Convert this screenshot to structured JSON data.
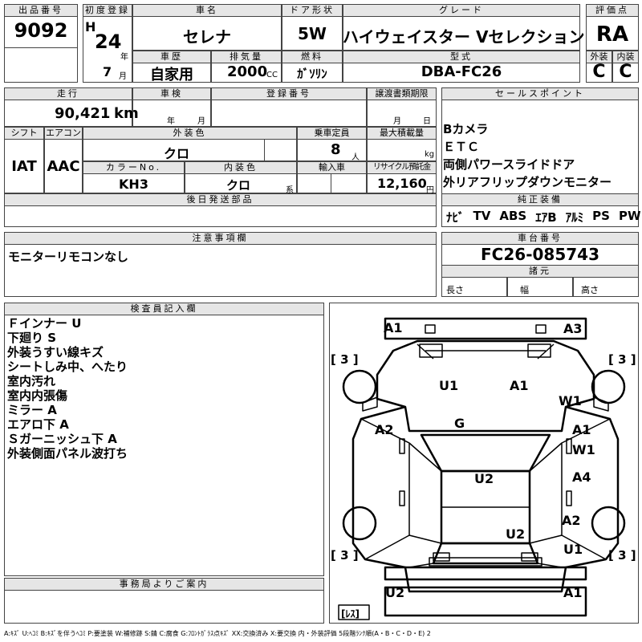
{
  "header": {
    "lot_label": "出品番号",
    "lot": "9092",
    "first_reg_label": "初度登録",
    "era": "H",
    "year": "24",
    "year_unit": "年",
    "month": "7",
    "month_unit": "月",
    "car_name_label": "車名",
    "car_name": "セレナ",
    "door_label": "ドア形状",
    "door": "5W",
    "grade_label": "グレード",
    "grade": "ハイウェイスター Vセレクション",
    "score_label": "評価点",
    "score": "RA",
    "history_label": "車歴",
    "history": "自家用",
    "displacement_label": "排気量",
    "displacement": "2000",
    "displacement_unit": "CC",
    "fuel_label": "燃料",
    "fuel": "ｶﾞｿﾘﾝ",
    "model_label": "型式",
    "model": "DBA-FC26",
    "ext_label": "外装",
    "ext": "C",
    "int_label": "内装",
    "int": "C"
  },
  "row2": {
    "mileage_label": "走行",
    "mileage": "90,421",
    "mileage_unit": "km",
    "inspection_label": "車検",
    "insp_year_unit": "年",
    "insp_month_unit": "月",
    "registration_label": "登録番号",
    "transfer_label": "譲渡書類期限",
    "transfer_month_unit": "月",
    "transfer_day_unit": "日",
    "shift_label": "シフト",
    "shift": "IAT",
    "ac_label": "エアコン",
    "ac": "AAC",
    "color_label": "外装色",
    "color": "クロ",
    "capacity_label": "乗車定員",
    "capacity": "8",
    "capacity_unit": "人",
    "load_label": "最大積載量",
    "load_unit": "kg",
    "color_no_label": "カラーNo.",
    "color_no": "KH3",
    "int_color_label": "内装色",
    "int_color": "クロ",
    "int_color_unit": "系",
    "import_label": "輸入車",
    "recycle_label": "リサイクル預託金",
    "recycle": "12,160",
    "recycle_unit": "円",
    "later_parts_label": "後日発送部品"
  },
  "sales_points": {
    "label": "セールスポイント",
    "items": [
      "Bカメラ",
      "ＥＴＣ",
      "両側パワースライドドア",
      "外リアフリップダウンモニター"
    ]
  },
  "equipment": {
    "label": "純正装備",
    "items": [
      "ﾅﾋﾞ",
      "TV",
      "ABS",
      "ｴｱB",
      "ｱﾙﾐ",
      "PS",
      "PW"
    ]
  },
  "caution": {
    "label": "注意事項欄",
    "text": "モニターリモコンなし"
  },
  "chassis": {
    "label": "車台番号",
    "value": "FC26-085743",
    "spec_label": "諸元",
    "length_label": "長さ",
    "width_label": "幅",
    "height_label": "高さ"
  },
  "inspector": {
    "label": "検査員記入欄",
    "lines": [
      "Ｆインナー U",
      "下廻り S",
      "外装うすい線キズ",
      "シートしみ中、へたり",
      "室内汚れ",
      "室内内張傷",
      "ミラー A",
      "エアロ下 A",
      "Ｓガーニッシュ下 A",
      "外装側面パネル波打ち"
    ]
  },
  "office": {
    "label": "事務局よりご案内"
  },
  "diagram": {
    "marks": [
      "A1",
      "A3",
      "U1",
      "A1",
      "W1",
      "G",
      "A2",
      "A1",
      "W1",
      "U2",
      "A4",
      "A2",
      "U2",
      "U1",
      "U2",
      "A1"
    ],
    "tire_labels": [
      "[ 3 ]",
      "[ 3 ]",
      "[ 3 ]",
      "[ 3 ]"
    ],
    "spare_label": "[ﾚｽ]"
  },
  "legend": "A:ｷｽﾞ U:ﾍｺﾐ B:ｷｽﾞを伴うﾍｺﾐ P:要塗装 W:補修跡 S:錆 C:腐食 G:ﾌﾛﾝﾄｶﾞﾗｽ点ｷｽﾞ XX:交換済み X:要交換 内・外装評価 5段階ﾗﾝｸ順(A・B・C・D・E) 2"
}
